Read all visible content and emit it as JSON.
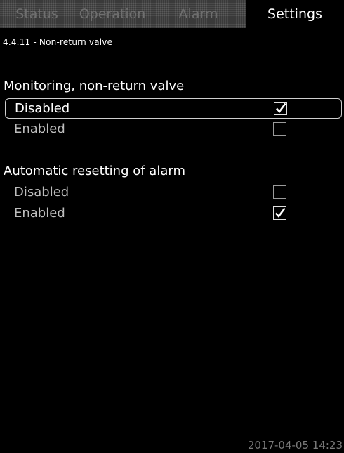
{
  "tabs": [
    {
      "label": "Status",
      "active": false
    },
    {
      "label": "Operation",
      "active": false
    },
    {
      "label": "Alarm",
      "active": false
    },
    {
      "label": "Settings",
      "active": true
    }
  ],
  "page": {
    "id_title": "4.4.11 - Non-return valve"
  },
  "sections": [
    {
      "title": "Monitoring, non-return valve",
      "options": [
        {
          "label": "Disabled",
          "checked": true,
          "focused": true
        },
        {
          "label": "Enabled",
          "checked": false,
          "focused": false
        }
      ]
    },
    {
      "title": "Automatic resetting of alarm",
      "options": [
        {
          "label": "Disabled",
          "checked": false,
          "focused": false
        },
        {
          "label": "Enabled",
          "checked": true,
          "focused": false
        }
      ]
    }
  ],
  "footer": {
    "datetime": "2017-04-05 14:23"
  },
  "icons": {
    "check": "checkmark-icon"
  }
}
